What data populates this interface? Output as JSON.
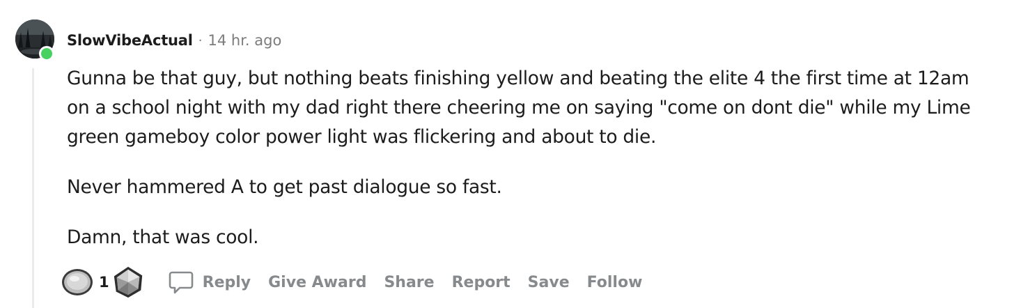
{
  "comment": {
    "username": "SlowVibeActual",
    "separator": "·",
    "timestamp": "14 hr. ago",
    "online_color": "#46d160",
    "avatar_icon": "user-avatar",
    "paragraphs": [
      "Gunna be that guy, but nothing beats finishing yellow and beating the elite 4 the first time at 12am on a school night with my dad right there cheering me on saying \"come on dont die\" while my Lime green gameboy color power light was flickering and about to die.",
      "Never hammered A to get past dialogue so fast.",
      "Damn, that was cool."
    ]
  },
  "actions": {
    "upvote_icon": "silver-award-icon",
    "score": "1",
    "downvote_icon": "platinum-award-icon",
    "reply_icon": "comment-bubble-icon",
    "reply": "Reply",
    "give_award": "Give Award",
    "share": "Share",
    "report": "Report",
    "save": "Save",
    "follow": "Follow",
    "action_color": "#878a8c"
  }
}
